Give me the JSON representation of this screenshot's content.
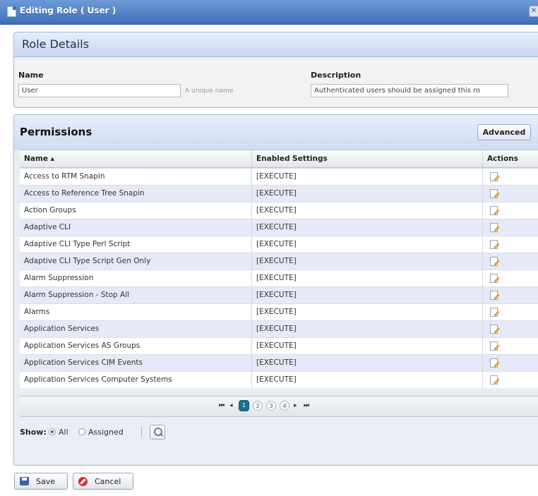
{
  "window": {
    "title": "Editing Role ( User )"
  },
  "details": {
    "heading": "Role Details",
    "name_label": "Name",
    "name_value": "User",
    "name_hint": "A unique name",
    "description_label": "Description",
    "description_value": "Authenticated users should be assigned this ro"
  },
  "permissions": {
    "heading": "Permissions",
    "advanced_label": "Advanced",
    "columns": [
      "Name ▴",
      "Enabled Settings",
      "Actions"
    ],
    "rows": [
      {
        "name": "Access to RTM Snapin",
        "settings": "[EXECUTE]"
      },
      {
        "name": "Access to Reference Tree Snapin",
        "settings": "[EXECUTE]"
      },
      {
        "name": "Action Groups",
        "settings": "[EXECUTE]"
      },
      {
        "name": "Adaptive CLI",
        "settings": "[EXECUTE]"
      },
      {
        "name": "Adaptive CLI Type Perl Script",
        "settings": "[EXECUTE]"
      },
      {
        "name": "Adaptive CLI Type Script Gen Only",
        "settings": "[EXECUTE]"
      },
      {
        "name": "Alarm Suppression",
        "settings": "[EXECUTE]"
      },
      {
        "name": "Alarm Suppression - Stop All",
        "settings": "[EXECUTE]"
      },
      {
        "name": "Alarms",
        "settings": "[EXECUTE]"
      },
      {
        "name": "Application Services",
        "settings": "[EXECUTE]"
      },
      {
        "name": "Application Services AS Groups",
        "settings": "[EXECUTE]"
      },
      {
        "name": "Application Services CIM Events",
        "settings": "[EXECUTE]"
      },
      {
        "name": "Application Services Computer Systems",
        "settings": "[EXECUTE]"
      }
    ],
    "pager": {
      "first": "⏮",
      "prev": "◂",
      "next": "▸",
      "last": "⏭",
      "pages": [
        "1",
        "2",
        "3",
        "4"
      ],
      "current_page": "1"
    },
    "show": {
      "label": "Show:",
      "options": [
        "All",
        "Assigned"
      ],
      "selected": "All"
    }
  },
  "footer": {
    "save_label": "Save",
    "cancel_label": "Cancel"
  }
}
